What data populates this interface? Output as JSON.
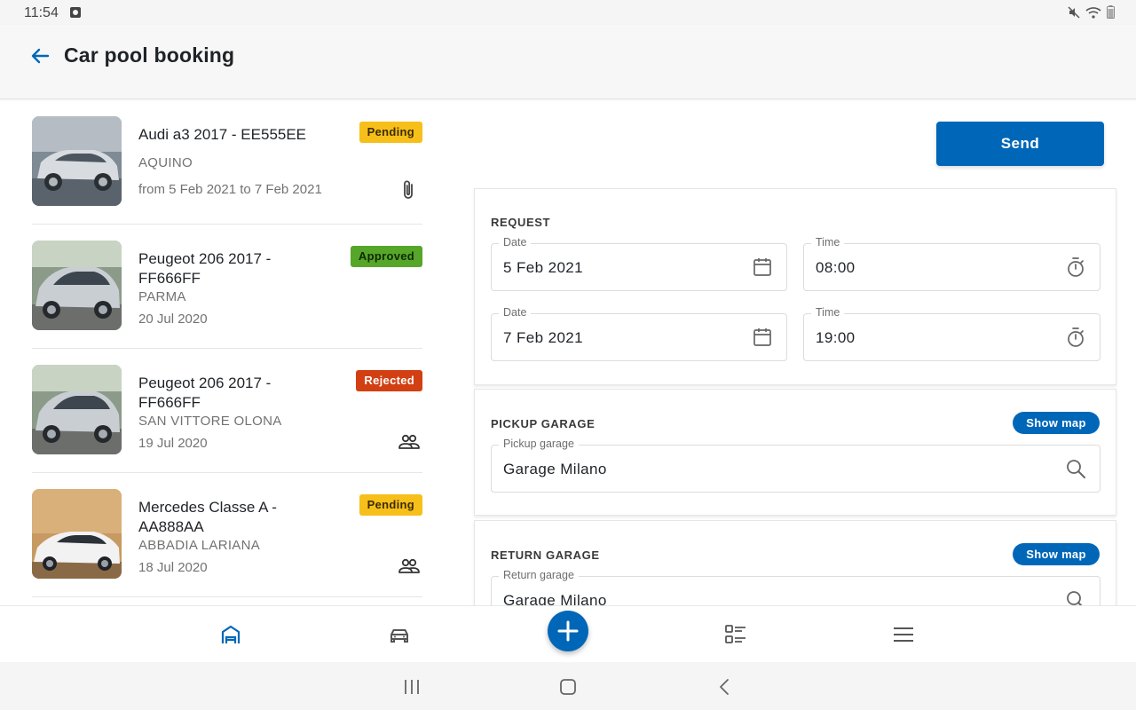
{
  "status_bar": {
    "time": "11:54"
  },
  "app_bar": {
    "title": "Car pool booking"
  },
  "bookings": [
    {
      "name": "Audi a3 2017 - EE555EE",
      "location": "AQUINO",
      "date": "from 5 Feb 2021 to 7 Feb 2021",
      "status": "Pending",
      "icon": "paperclip-icon"
    },
    {
      "name": "Peugeot 206 2017 - FF666FF",
      "location": "PARMA",
      "date": "20 Jul 2020",
      "status": "Approved",
      "icon": ""
    },
    {
      "name": "Peugeot 206 2017 - FF666FF",
      "location": "SAN VITTORE OLONA",
      "date": "19 Jul 2020",
      "status": "Rejected",
      "icon": "people-icon"
    },
    {
      "name": "Mercedes Classe A - AA888AA",
      "location": "ABBADIA LARIANA",
      "date": "18 Jul 2020",
      "status": "Pending",
      "icon": "people-icon"
    }
  ],
  "send_label": "Send",
  "request": {
    "title": "REQUEST",
    "date_label": "Date",
    "time_label": "Time",
    "start_date": "5 Feb 2021",
    "start_time": "08:00",
    "end_date": "7 Feb 2021",
    "end_time": "19:00"
  },
  "pickup": {
    "title": "PICKUP GARAGE",
    "show_map": "Show map",
    "field_label": "Pickup garage",
    "value": "Garage Milano"
  },
  "return": {
    "title": "RETURN GARAGE",
    "show_map": "Show map",
    "field_label": "Return garage",
    "value": "Garage Milano"
  },
  "colors": {
    "primary": "#0067b8",
    "pending": "#f6bf1a",
    "approved": "#56a62a",
    "rejected": "#d23f12"
  },
  "bottom_nav": {
    "icons": [
      "garage-icon",
      "car-icon",
      "add-icon",
      "checklist-icon",
      "menu-icon"
    ]
  }
}
